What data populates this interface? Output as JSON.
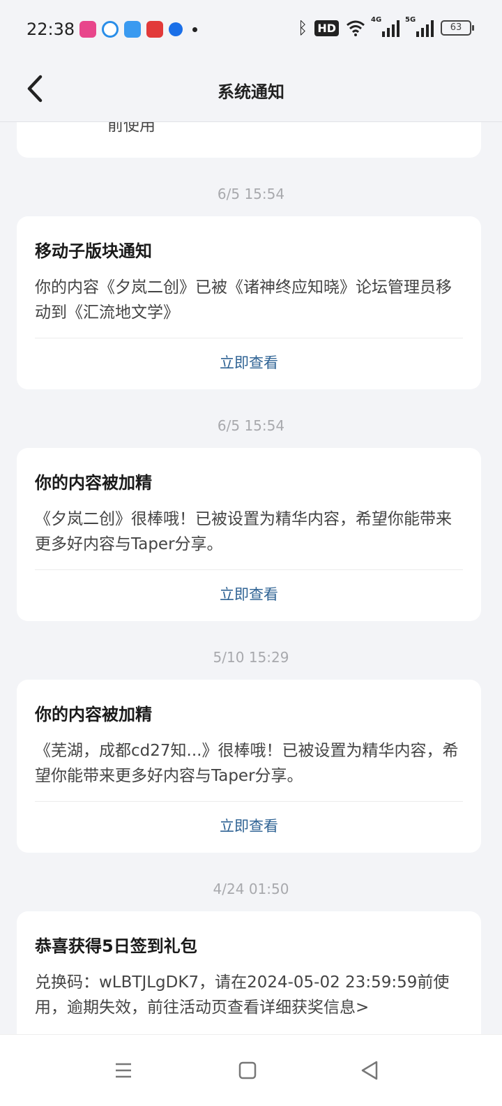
{
  "status_bar": {
    "time": "22:38",
    "hd_label": "HD",
    "network_1": "4G",
    "network_2": "5G",
    "battery": "63"
  },
  "header": {
    "title": "系统通知"
  },
  "top_card_partial_text": "前使用",
  "notifications": [
    {
      "timestamp": "6/5  15:54",
      "title": "移动子版块通知",
      "body": "你的内容《夕岚二创》已被《诸神终应知晓》论坛管理员移动到《汇流地文学》",
      "action": "立即查看"
    },
    {
      "timestamp": "6/5  15:54",
      "title": "你的内容被加精",
      "body": "《夕岚二创》很棒哦！已被设置为精华内容，希望你能带来更多好内容与Taper分享。",
      "action": "立即查看"
    },
    {
      "timestamp": "5/10  15:29",
      "title": "你的内容被加精",
      "body": "《芜湖，成都cd27知...》很棒哦！已被设置为精华内容，希望你能带来更多好内容与Taper分享。",
      "action": "立即查看"
    },
    {
      "timestamp": "4/24  01:50",
      "title": "恭喜获得5日签到礼包",
      "body": "兑换码：wLBTJLgDK7，请在2024-05-02 23:59:59前使用，逾期失效，前往活动页查看详细获奖信息>"
    }
  ],
  "colors": {
    "background": "#f3f4f7",
    "card": "#ffffff",
    "action_link": "#2f6394",
    "timestamp": "#a8a9ad"
  }
}
